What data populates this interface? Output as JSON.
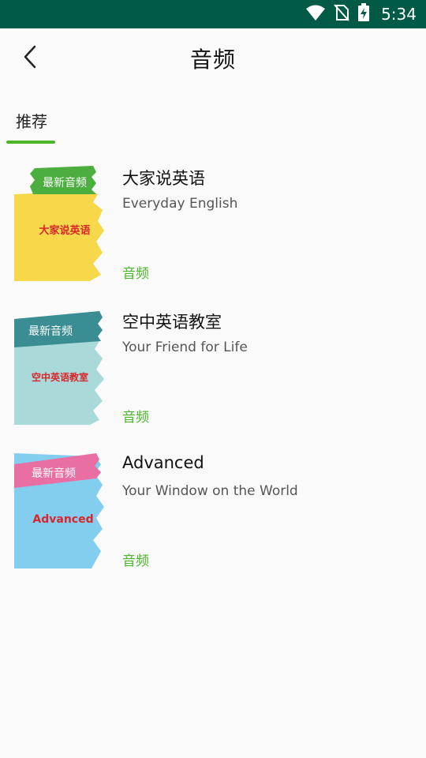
{
  "status_bar": {
    "time": "5:34"
  },
  "header": {
    "title": "音频"
  },
  "tabs": [
    {
      "label": "推荐",
      "active": true
    }
  ],
  "colors": {
    "status_bar_bg": "#005a45",
    "accent": "#4cb52a"
  },
  "items": [
    {
      "title": "大家说英语",
      "subtitle": "Everyday English",
      "tag": "音频",
      "cover": {
        "banner": "最新音频",
        "logo_text": "大家说英语",
        "banner_color": "#4cae3f",
        "bg_color": "#f7d84a"
      }
    },
    {
      "title": "空中英语教室",
      "subtitle": "Your Friend for Life",
      "tag": "音频",
      "cover": {
        "banner": "最新音频",
        "logo_text": "空中英语教室",
        "banner_color": "#3a8d92",
        "bg_color": "#a9dad9"
      }
    },
    {
      "title": "Advanced",
      "subtitle": "Your Window on the World",
      "tag": "音频",
      "cover": {
        "banner": "最新音频",
        "logo_text": "Advanced",
        "banner_color": "#e96fa3",
        "bg_color": "#83cdef"
      }
    }
  ]
}
